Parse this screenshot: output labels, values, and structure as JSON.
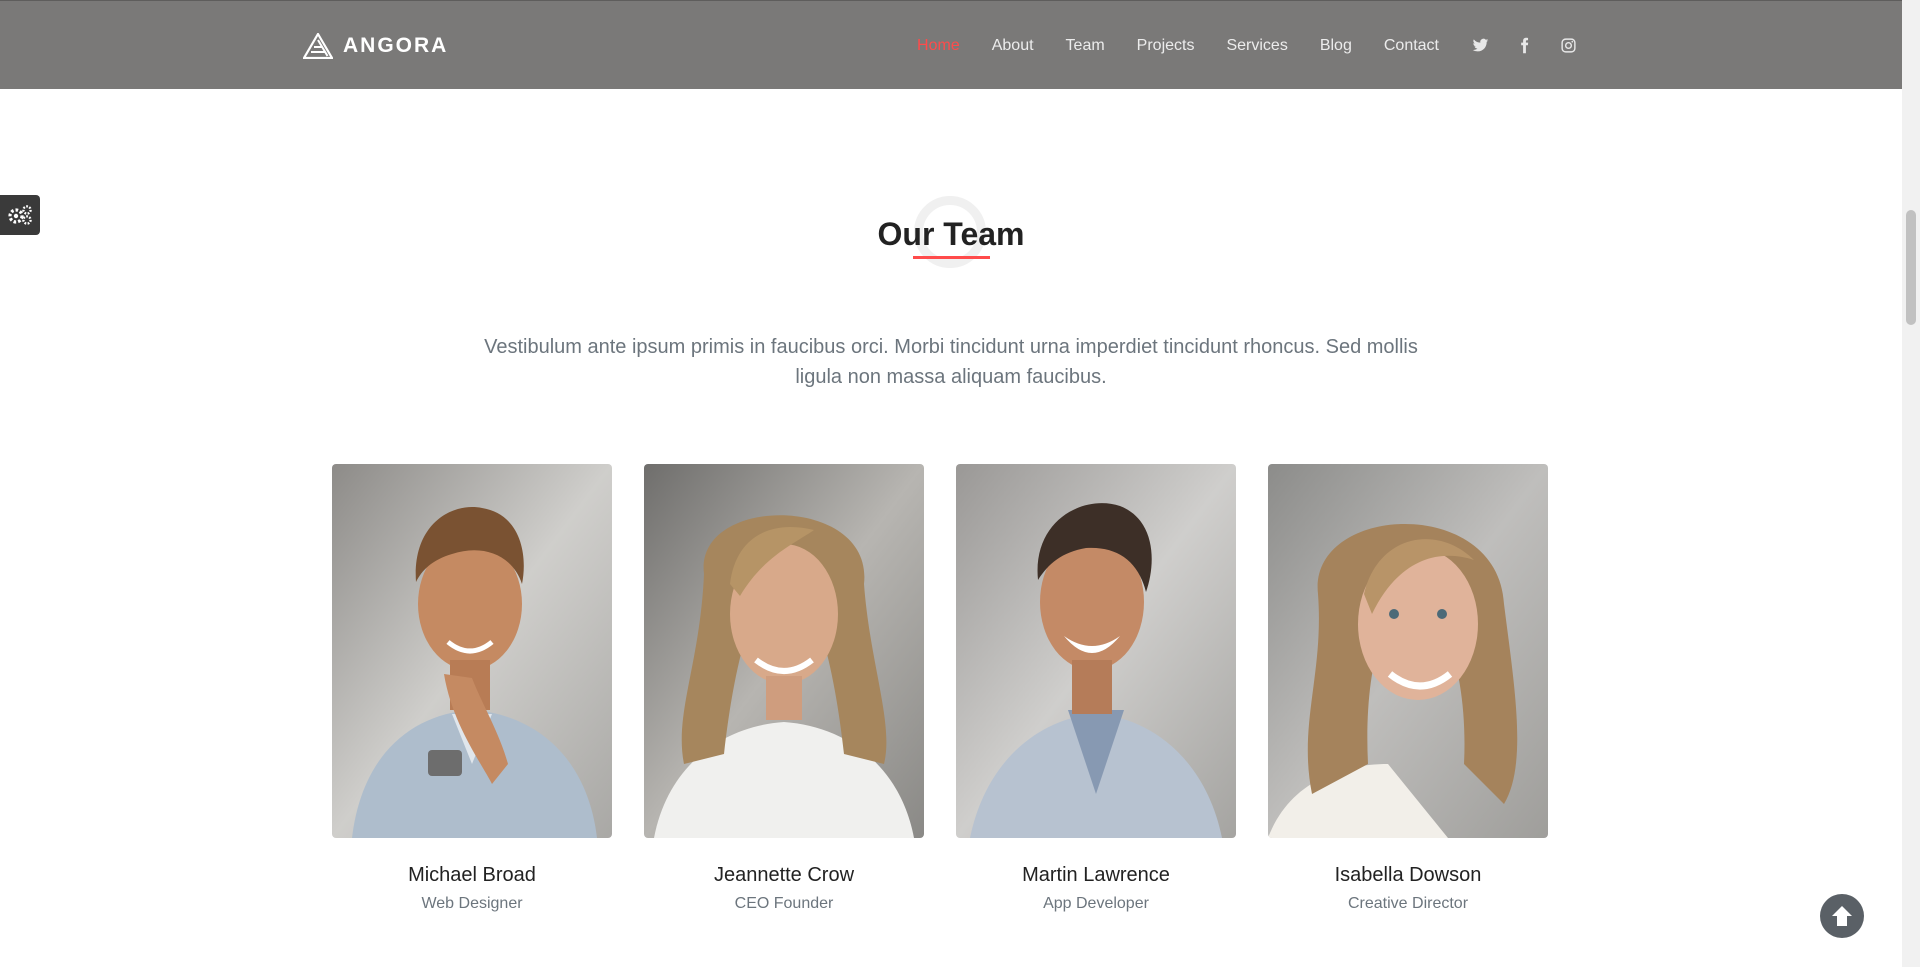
{
  "brand": {
    "name": "ANGORA"
  },
  "nav": {
    "items": [
      {
        "label": "Home",
        "active": true
      },
      {
        "label": "About",
        "active": false
      },
      {
        "label": "Team",
        "active": false
      },
      {
        "label": "Projects",
        "active": false
      },
      {
        "label": "Services",
        "active": false
      },
      {
        "label": "Blog",
        "active": false
      },
      {
        "label": "Contact",
        "active": false
      }
    ],
    "social": [
      "twitter-icon",
      "facebook-icon",
      "instagram-icon"
    ]
  },
  "colors": {
    "navbar_bg": "#7a7978",
    "accent": "#ff4b4b",
    "heading": "#222222",
    "muted": "#6c757d"
  },
  "team_section": {
    "title": "Our Team",
    "description": "Vestibulum ante ipsum primis in faucibus orci. Morbi tincidunt urna imperdiet tincidunt rhoncus. Sed mollis ligula non massa aliquam faucibus.",
    "members": [
      {
        "name": "Michael Broad",
        "role": "Web Designer"
      },
      {
        "name": "Jeannette Crow",
        "role": "CEO Founder"
      },
      {
        "name": "Martin Lawrence",
        "role": "App Developer"
      },
      {
        "name": "Isabella Dowson",
        "role": "Creative Director"
      }
    ]
  },
  "widgets": {
    "settings_icon": "gears-icon",
    "scroll_top_icon": "arrow-up-circle-icon"
  }
}
